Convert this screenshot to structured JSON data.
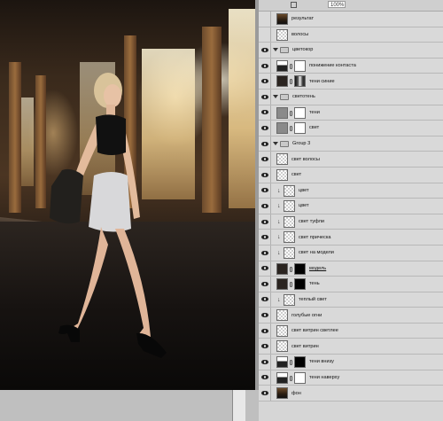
{
  "panel": {
    "opacity_value": "100%",
    "layers": [
      {
        "name": "результат",
        "type": "layer",
        "visible": false,
        "thumb": "photo"
      },
      {
        "name": "волосы",
        "type": "layer",
        "visible": false,
        "thumb": "checker"
      },
      {
        "name": "цветокор",
        "type": "group",
        "visible": true
      },
      {
        "name": "понижение контаста",
        "type": "adjustment",
        "visible": true,
        "thumb": "curves",
        "mask": "white"
      },
      {
        "name": "тени синие",
        "type": "adjustment",
        "visible": true,
        "thumb": "dark",
        "mask": "bw-wave"
      },
      {
        "name": "светотень",
        "type": "group",
        "visible": true
      },
      {
        "name": "тени",
        "type": "layer",
        "visible": true,
        "thumb": "gray",
        "mask": "white"
      },
      {
        "name": "свет",
        "type": "layer",
        "visible": true,
        "thumb": "gray",
        "mask": "white"
      },
      {
        "name": "Group 3",
        "type": "group",
        "visible": true
      },
      {
        "name": "свет волосы",
        "type": "layer",
        "visible": true,
        "thumb": "checker"
      },
      {
        "name": "свет",
        "type": "layer",
        "visible": true,
        "thumb": "checker"
      },
      {
        "name": "цвет",
        "type": "layer",
        "visible": true,
        "thumb": "checker",
        "clipped": true
      },
      {
        "name": "цвет",
        "type": "layer",
        "visible": true,
        "thumb": "checker",
        "clipped": true
      },
      {
        "name": "свет туфли",
        "type": "layer",
        "visible": true,
        "thumb": "checker",
        "clipped": true
      },
      {
        "name": "свет прическа",
        "type": "layer",
        "visible": true,
        "thumb": "checker",
        "clipped": true
      },
      {
        "name": "свет на модели",
        "type": "layer",
        "visible": true,
        "thumb": "checker",
        "clipped": true
      },
      {
        "name": "модель",
        "type": "layer",
        "visible": true,
        "thumb": "dark",
        "mask": "black-figure",
        "underline": true
      },
      {
        "name": "тень",
        "type": "layer",
        "visible": true,
        "thumb": "dark",
        "mask": "black-figure"
      },
      {
        "name": "теплый свет",
        "type": "layer",
        "visible": true,
        "thumb": "checker",
        "clipped": true
      },
      {
        "name": "голубые огни",
        "type": "layer",
        "visible": true,
        "thumb": "checker"
      },
      {
        "name": "свет витрин светлее",
        "type": "layer",
        "visible": true,
        "thumb": "checker"
      },
      {
        "name": "свет витрин",
        "type": "layer",
        "visible": true,
        "thumb": "checker"
      },
      {
        "name": "тени внизу",
        "type": "adjustment",
        "visible": true,
        "thumb": "curves",
        "mask": "black"
      },
      {
        "name": "тени наверху",
        "type": "adjustment",
        "visible": true,
        "thumb": "curves",
        "mask": "white-grad"
      },
      {
        "name": "фон",
        "type": "layer",
        "visible": true,
        "thumb": "photo"
      }
    ]
  }
}
